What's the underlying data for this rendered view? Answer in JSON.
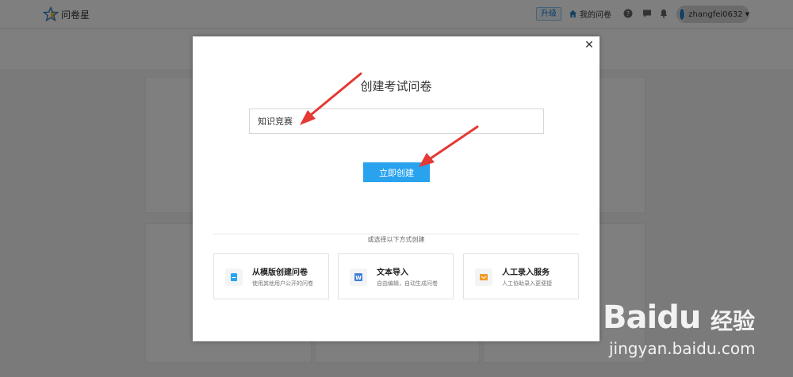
{
  "header": {
    "brand": "问卷星",
    "upgrade_label": "升级",
    "my_surveys_label": "我的问卷",
    "username": "zhangfei0632"
  },
  "dialog": {
    "title": "创建考试问卷",
    "name_value": "知识竞赛",
    "create_label": "立即创建",
    "divider_label": "或选择以下方式创建",
    "options": [
      {
        "title": "从模版创建问卷",
        "desc": "使用其他用户公开的问卷",
        "icon": "template-doc-icon",
        "color": "#2aa3ef"
      },
      {
        "title": "文本导入",
        "desc": "自由编辑，自动生成问卷",
        "icon": "text-import-icon",
        "color": "#3f7fd8"
      },
      {
        "title": "人工录入服务",
        "desc": "人工协助录入更便捷",
        "icon": "manual-entry-icon",
        "color": "#f29a24"
      }
    ]
  },
  "watermark": {
    "logo": "Baidu",
    "jingyan": "经验",
    "url": "jingyan.baidu.com"
  },
  "colors": {
    "accent": "#2aa3ef",
    "annotation_arrow": "#e53935"
  }
}
